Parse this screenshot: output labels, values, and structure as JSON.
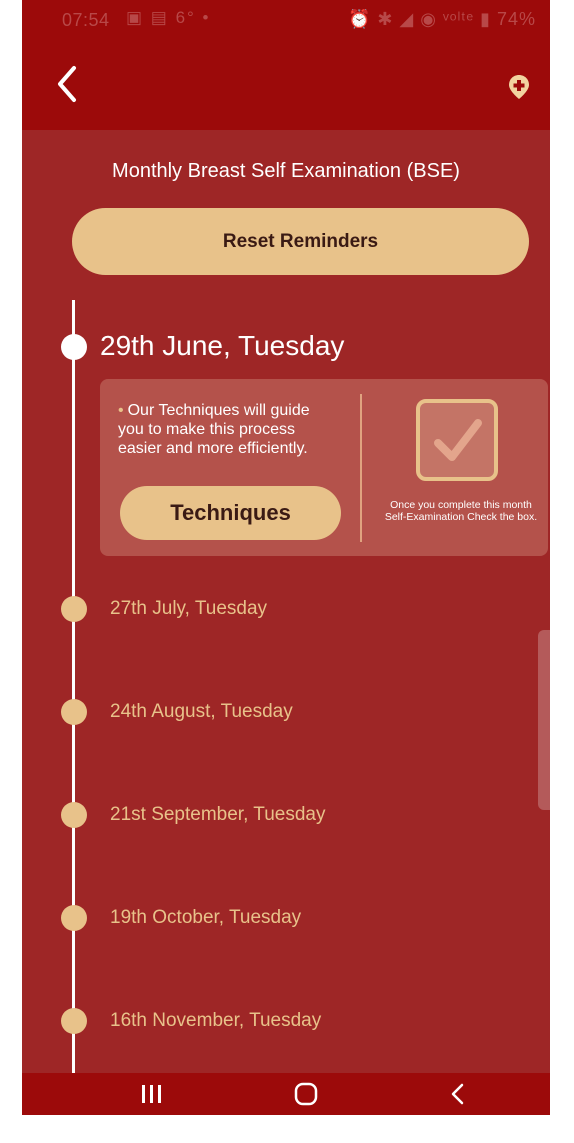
{
  "status_bar": {
    "time": "07:54",
    "system_icons": "▣ ▤ 6° •",
    "right_icons": "⏰ ✱ ◢ ◉ ᵛᵒˡᵗᵉ ▮",
    "battery": "74%"
  },
  "header": {
    "back_icon": "chevron-left-icon",
    "add_icon": "location-plus-icon"
  },
  "title": "Monthly Breast Self Examination (BSE)",
  "reset_button": "Reset Reminders",
  "current": {
    "date": "29th June, Tuesday",
    "bullet": "•",
    "tip": "Our Techniques will guide you to make this process easier and more efficiently.",
    "techniques_button": "Techniques",
    "checkbox_checked": true,
    "check_note": "Once you complete this month Self-Examination Check the box."
  },
  "reminders": [
    "27th July, Tuesday",
    "24th August, Tuesday",
    "21st September, Tuesday",
    "19th October, Tuesday",
    "16th November, Tuesday"
  ],
  "colors": {
    "header": "#9c0a0a",
    "background": "#9e2626",
    "accent": "#e8c28a",
    "card": "#b4524b"
  },
  "navbar": [
    "recent-apps-icon",
    "home-icon",
    "back-icon"
  ]
}
